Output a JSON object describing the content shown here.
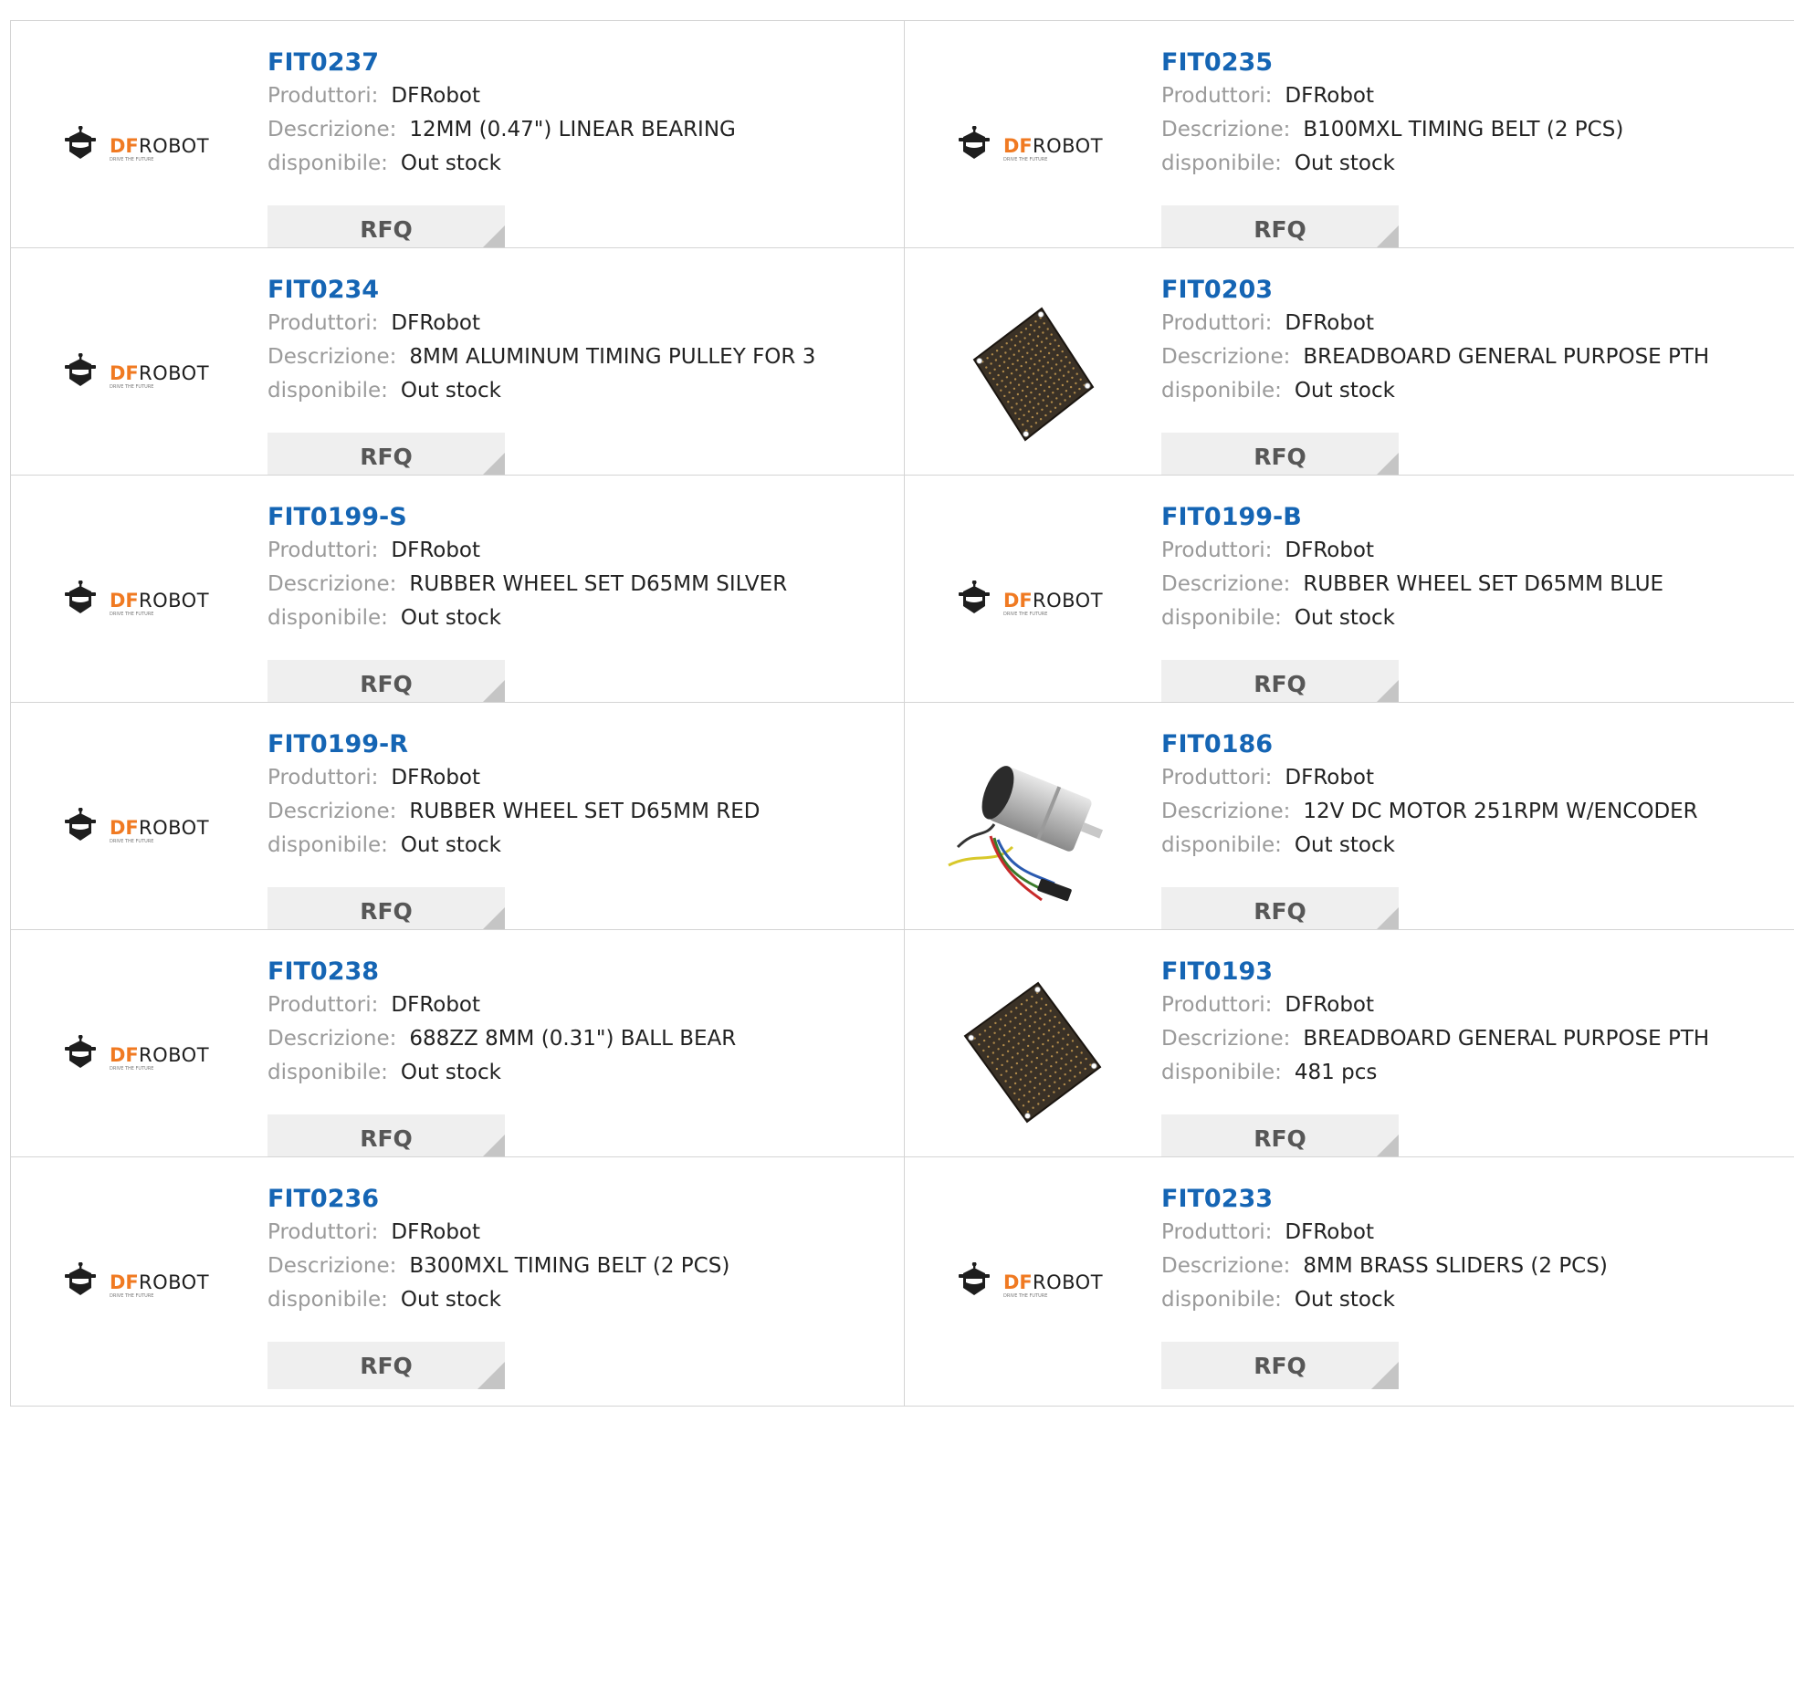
{
  "labels": {
    "manufacturer": "Produttori:",
    "description": "Descrizione:",
    "availability": "disponibile:",
    "rfq": "RFQ"
  },
  "logo": {
    "brand_df": "DF",
    "brand_robot": "ROBOT",
    "tagline": "DRIVE THE FUTURE"
  },
  "products": [
    {
      "pn": "FIT0237",
      "manufacturer": "DFRobot",
      "description": "12MM (0.47\") LINEAR BEARING",
      "availability": "Out stock",
      "image": "dfrobot-logo"
    },
    {
      "pn": "FIT0235",
      "manufacturer": "DFRobot",
      "description": "B100MXL TIMING BELT (2 PCS)",
      "availability": "Out stock",
      "image": "dfrobot-logo"
    },
    {
      "pn": "FIT0234",
      "manufacturer": "DFRobot",
      "description": "8MM ALUMINUM TIMING PULLEY FOR 3",
      "availability": "Out stock",
      "image": "dfrobot-logo"
    },
    {
      "pn": "FIT0203",
      "manufacturer": "DFRobot",
      "description": "BREADBOARD GENERAL PURPOSE PTH",
      "availability": "Out stock",
      "image": "breadboard-small"
    },
    {
      "pn": "FIT0199-S",
      "manufacturer": "DFRobot",
      "description": "RUBBER WHEEL SET D65MM SILVER",
      "availability": "Out stock",
      "image": "dfrobot-logo"
    },
    {
      "pn": "FIT0199-B",
      "manufacturer": "DFRobot",
      "description": "RUBBER WHEEL SET D65MM BLUE",
      "availability": "Out stock",
      "image": "dfrobot-logo"
    },
    {
      "pn": "FIT0199-R",
      "manufacturer": "DFRobot",
      "description": "RUBBER WHEEL SET D65MM RED",
      "availability": "Out stock",
      "image": "dfrobot-logo"
    },
    {
      "pn": "FIT0186",
      "manufacturer": "DFRobot",
      "description": "12V DC MOTOR 251RPM W/ENCODER",
      "availability": "Out stock",
      "image": "dc-motor"
    },
    {
      "pn": "FIT0238",
      "manufacturer": "DFRobot",
      "description": "688ZZ 8MM (0.31\") BALL BEAR",
      "availability": "Out stock",
      "image": "dfrobot-logo"
    },
    {
      "pn": "FIT0193",
      "manufacturer": "DFRobot",
      "description": "BREADBOARD GENERAL PURPOSE PTH",
      "availability": "481 pcs",
      "image": "breadboard-large"
    },
    {
      "pn": "FIT0236",
      "manufacturer": "DFRobot",
      "description": "B300MXL TIMING BELT (2 PCS)",
      "availability": "Out stock",
      "image": "dfrobot-logo"
    },
    {
      "pn": "FIT0233",
      "manufacturer": "DFRobot",
      "description": "8MM BRASS SLIDERS (2 PCS)",
      "availability": "Out stock",
      "image": "dfrobot-logo"
    }
  ],
  "colors": {
    "part_number": "#1565b4",
    "label": "#9a9a9a",
    "value": "#222222",
    "logo_orange": "#f07a22",
    "logo_dark": "#1e1e1e",
    "rfq_bg": "#efefef",
    "border": "#d4d4d4"
  }
}
